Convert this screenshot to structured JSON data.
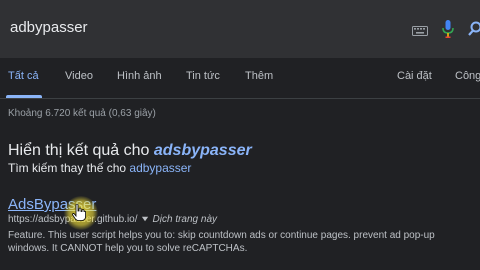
{
  "search": {
    "query": "adbypasser"
  },
  "icons": {
    "keyboard": "keyboard-icon",
    "mic": "mic-icon",
    "search": "search-icon",
    "cursor": "hand-cursor-icon"
  },
  "tabs": [
    {
      "label": "Tất cả",
      "active": true
    },
    {
      "label": "Video"
    },
    {
      "label": "Hình ảnh"
    },
    {
      "label": "Tin tức"
    },
    {
      "label": "Thêm"
    }
  ],
  "tools": {
    "settings": "Cài đặt",
    "tools": "Công"
  },
  "stats": "Khoảng 6.720 kết quả (0,63 giây)",
  "spell": {
    "prefix": "Hiển thị kết quả cho ",
    "corrected": "adsbypasser",
    "instead_prefix": "Tìm kiếm thay thế cho ",
    "original": "adbypasser"
  },
  "result": {
    "title": "AdsBypasser",
    "url": "https://adsbypasser.github.io/",
    "translate": "Dịch trang này",
    "snippet": "Feature. This user script helps you to: skip countdown ads or continue pages. prevent ad pop-up windows. It CANNOT help you to solve reCAPTCHAs."
  },
  "colors": {
    "background": "#202124",
    "searchbar": "#303134",
    "link": "#8ab4f8",
    "text": "#bdc1c6",
    "highlight": "#ffeb3b"
  }
}
